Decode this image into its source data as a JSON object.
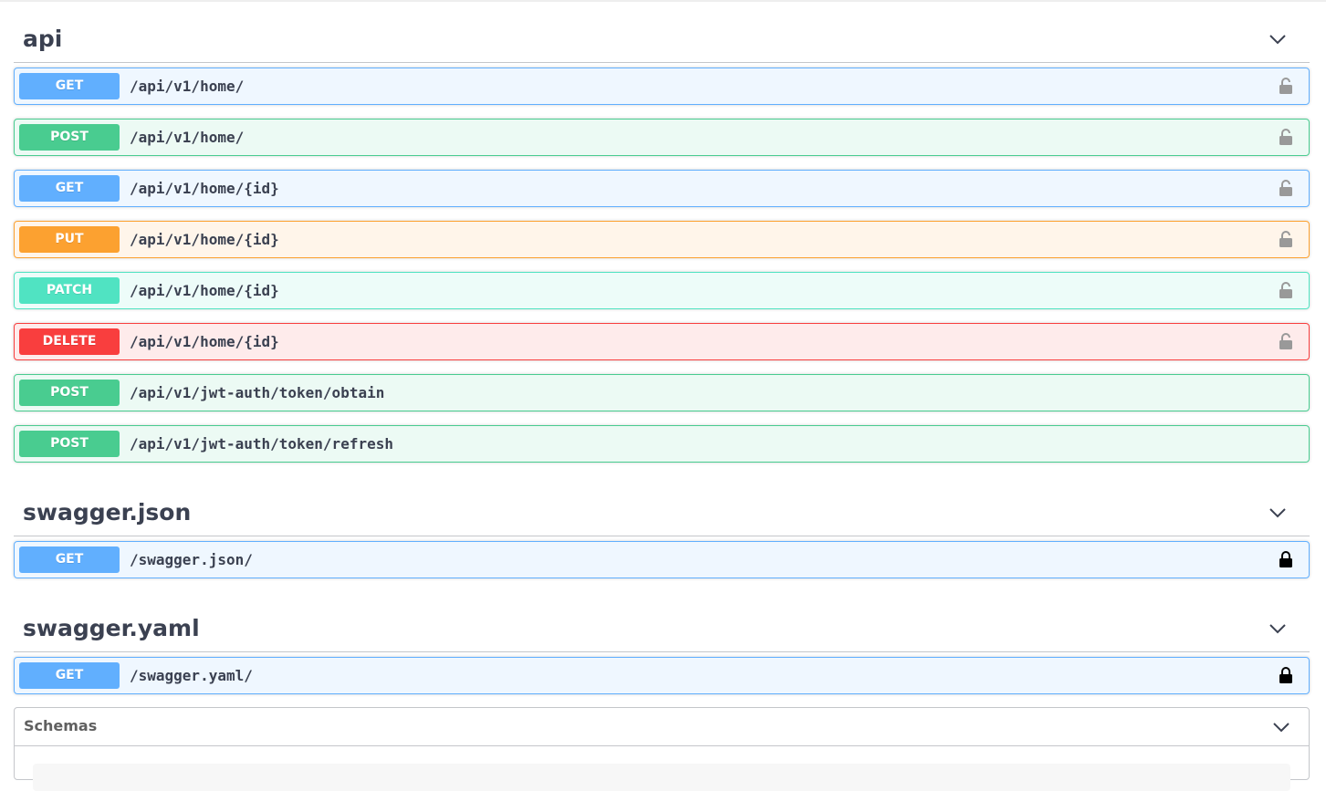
{
  "sections": [
    {
      "title": "api",
      "operations": [
        {
          "method": "GET",
          "path": "/api/v1/home/",
          "lock": "unlocked"
        },
        {
          "method": "POST",
          "path": "/api/v1/home/",
          "lock": "unlocked"
        },
        {
          "method": "GET",
          "path": "/api/v1/home/{id}",
          "lock": "unlocked"
        },
        {
          "method": "PUT",
          "path": "/api/v1/home/{id}",
          "lock": "unlocked"
        },
        {
          "method": "PATCH",
          "path": "/api/v1/home/{id}",
          "lock": "unlocked"
        },
        {
          "method": "DELETE",
          "path": "/api/v1/home/{id}",
          "lock": "unlocked"
        },
        {
          "method": "POST",
          "path": "/api/v1/jwt-auth/token/obtain"
        },
        {
          "method": "POST",
          "path": "/api/v1/jwt-auth/token/refresh"
        }
      ]
    },
    {
      "title": "swagger.json",
      "operations": [
        {
          "method": "GET",
          "path": "/swagger.json/",
          "lock": "locked"
        }
      ]
    },
    {
      "title": "swagger.yaml",
      "operations": [
        {
          "method": "GET",
          "path": "/swagger.yaml/",
          "lock": "locked"
        }
      ]
    }
  ],
  "schemas": {
    "title": "Schemas"
  },
  "colors": {
    "GET": "#61affe",
    "POST": "#49cc90",
    "PUT": "#fca130",
    "PATCH": "#50e3c2",
    "DELETE": "#f93e3e",
    "text": "#3b4151"
  },
  "icons": {
    "collapse": "chevron-down-icon",
    "auth_unlocked": "unlocked-icon",
    "auth_locked": "locked-icon"
  }
}
